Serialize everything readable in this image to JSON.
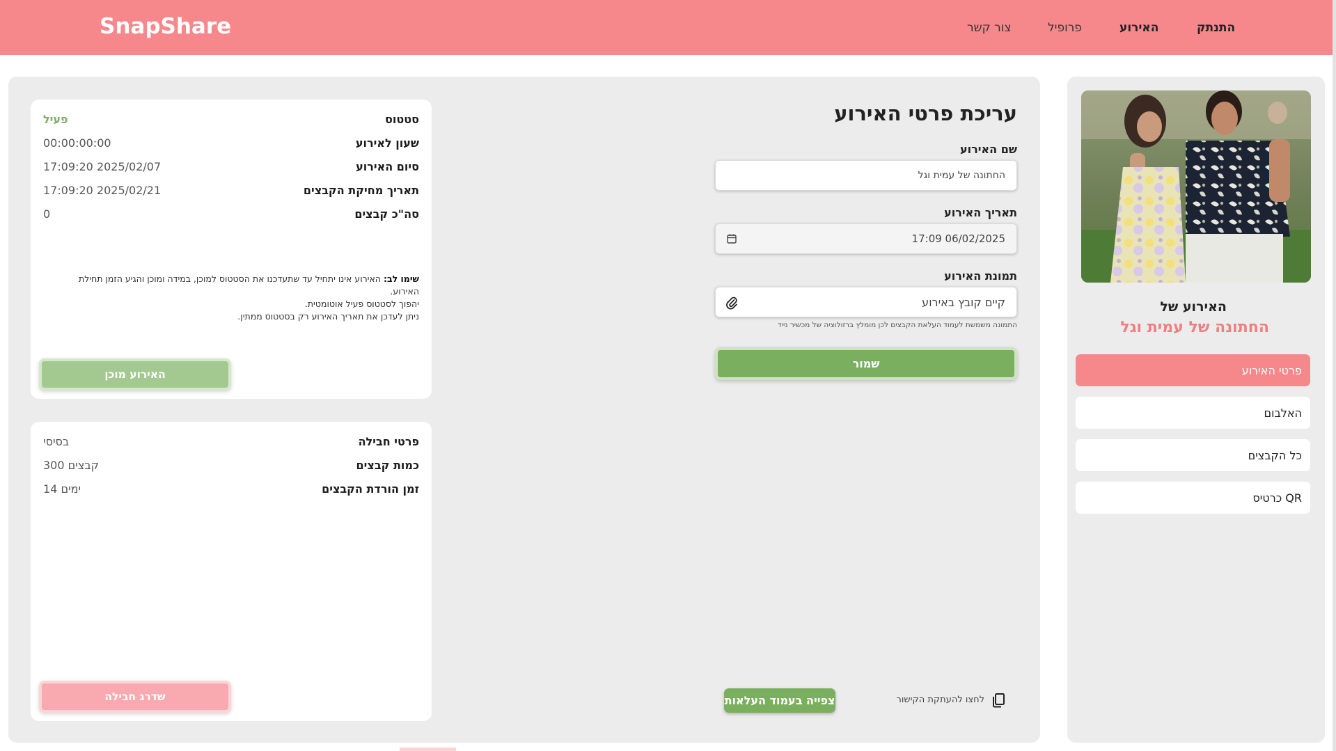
{
  "header": {
    "logo": "SnapShare",
    "nav": [
      "התנתק",
      "האירוע",
      "פרופיל",
      "צור קשר"
    ],
    "color": "#f6878b"
  },
  "status_card": {
    "rows": [
      {
        "label": "סטטוס",
        "value": "פעיל"
      },
      {
        "label": "שעון לאירוע",
        "value": "00:00:00:00"
      },
      {
        "label": "סיום האירוע",
        "value": "17:09:20 2025/02/07"
      },
      {
        "label": "תאריך מחיקת הקבצים",
        "value": "17:09:20 2025/02/21"
      },
      {
        "label": "סה\"כ קבצים",
        "value": "0"
      }
    ],
    "note_title": "שימו לב:",
    "note_line1": " האירוע אינו יתחיל עד שתעדכנו את הסטטוס למוכן, במידה ומוכן והגיע הזמן תחילת האירוע.",
    "note_line2": "יהפוך לסטטוס פעיל אוטומטית.",
    "note_line3": "ניתן לעדכן את תאריך האירוע רק בסטטוס ממתין.",
    "ready_button": "האירוע מוכן"
  },
  "package_card": {
    "rows": [
      {
        "label": "פרטי חבילה",
        "value": "בסיסי"
      },
      {
        "label": "כמות קבצים",
        "value": "300 קבצים"
      },
      {
        "label": "זמן הורדת הקבצים",
        "value": "14 ימים"
      }
    ],
    "upgrade_button": "שדרג חבילה"
  },
  "form": {
    "title": "עריכת פרטי האירוע",
    "name_label": "שם האירוע",
    "name_value": "החתונה של עמית וגל",
    "date_label": "תאריך האירוע",
    "date_value": "17:09 06/02/2025",
    "image_label": "תמונת האירוע",
    "image_value": "קיים קובץ באירוע",
    "image_hint": "התמונה משמשת לעמוד העלאת הקבצים לכן מומלץ ברזולוציה של מכשיר נייד",
    "save_button": "שמור",
    "view_button": "צפייה בעמוד העלאות",
    "copy_text": "לחצו להעתקת הקישור"
  },
  "sidebar": {
    "event_of": "האירוע של",
    "event_name": "החתונה של עמית וגל",
    "items": [
      "פרטי האירוע",
      "האלבום",
      "כל הקבצים",
      "כרטיס QR"
    ],
    "active_color": "#f6878b"
  },
  "colors": {
    "green": "#7aaf5f",
    "green_soft": "#a3c990",
    "pink_soft": "#f8aab0",
    "status_active": "#7cae63",
    "panel": "#ececec"
  }
}
